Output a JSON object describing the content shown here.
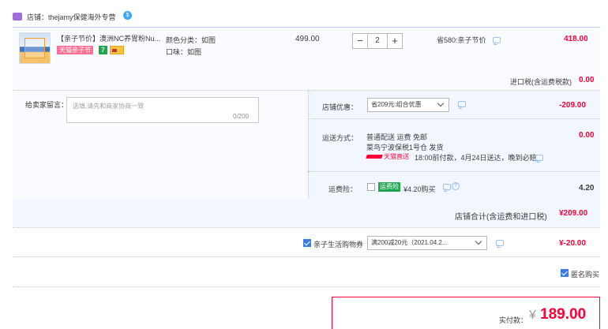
{
  "shop": {
    "label": "店铺：thejamy保健海外专营",
    "badge": "$"
  },
  "product": {
    "title": "【亲子节价】澳洲NC养胃粉Nu...",
    "tag_festival": "天猫亲子节",
    "tag_seven": "7",
    "sku_color": "颜色分类：如图",
    "sku_flavor": "口味：如图",
    "unit_price": "499.00",
    "quantity": "2",
    "minus_label": "−",
    "plus_label": "+",
    "save_text": "省580:亲子节价",
    "subtotal": "418.00"
  },
  "import_tax": {
    "label": "进口税(含运费税款)",
    "value": "0.00"
  },
  "message": {
    "label": "给卖家留言：",
    "placeholder": "选填,请先和商家协商一致",
    "count": "0/200"
  },
  "shop_discount": {
    "label": "店铺优惠：",
    "selected": "省209元:组合优惠",
    "value": "-209.00"
  },
  "shipping": {
    "label": "运送方式：",
    "line1": "普通配送 运费 免邮",
    "line2": "菜鸟宁波保税1号仓   发货",
    "tmall_text": "天猫直送",
    "line3": "18:00前付款，4月24日送达，晚到必赔",
    "value": "0.00"
  },
  "insurance": {
    "label": "运费险：",
    "tag": "运费险",
    "text": "¥4.20购买",
    "help": "?",
    "value": "4.20"
  },
  "shop_total": {
    "label": "店铺合计(含运费和进口税)",
    "value": "¥209.00"
  },
  "coupon": {
    "label": "亲子生活购物券",
    "selected": "满200减20元（2021.04.2...",
    "value": "¥-20.00"
  },
  "anonymous": {
    "label": "匿名购买"
  },
  "payment": {
    "label": "实付款：",
    "currency": "¥",
    "amount": "189.00"
  },
  "colors": {
    "accent_red": "#ff0036",
    "accent_blue": "#3d7ce4",
    "row_bg": "#f2f7ff"
  }
}
